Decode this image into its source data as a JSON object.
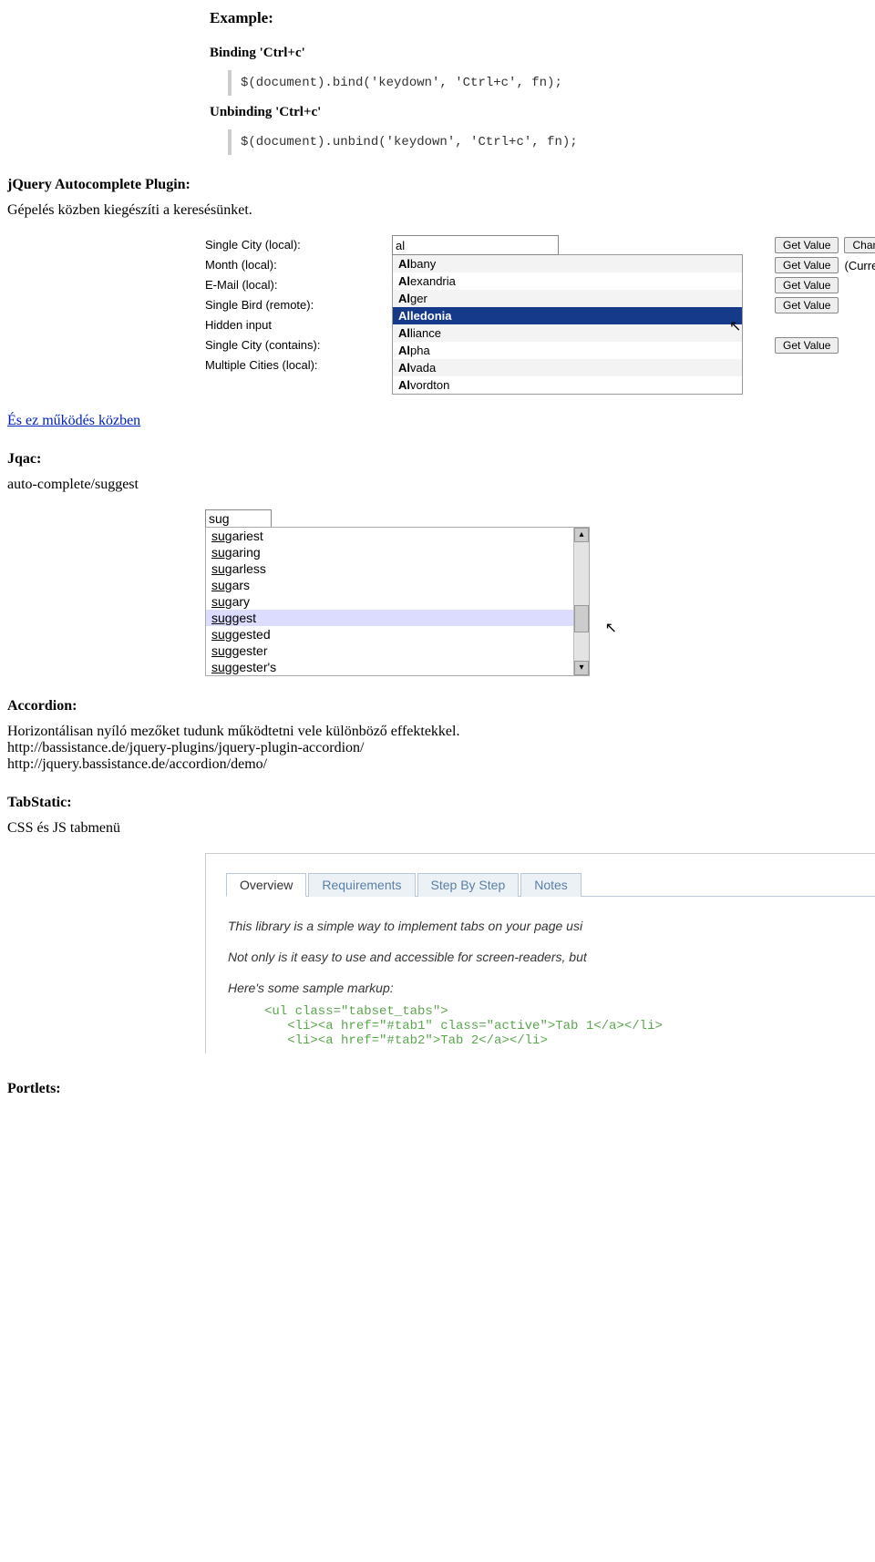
{
  "example": {
    "heading": "Example:",
    "bind_title": "Binding 'Ctrl+c'",
    "bind_code": "$(document).bind('keydown', 'Ctrl+c', fn);",
    "unbind_title": "Unbinding 'Ctrl+c'",
    "unbind_code": "$(document).unbind('keydown', 'Ctrl+c', fn);"
  },
  "autocomplete": {
    "heading": "jQuery Autocomplete Plugin:",
    "desc": "Gépelés közben kiegészíti a keresésünket.",
    "labels": [
      "Single City (local):",
      "Month (local):",
      "E-Mail (local):",
      "Single Bird (remote):",
      "Hidden input",
      "Single City (contains):",
      "Multiple Cities (local):"
    ],
    "input_value": "al",
    "suggestions": [
      "Albany",
      "Alexandria",
      "Alger",
      "Alledonia",
      "Alliance",
      "Alpha",
      "Alvada",
      "Alvordton"
    ],
    "selected_index": 3,
    "btn_get": "Get Value",
    "btn_change": "Change M",
    "text_current": "(Current m",
    "link_text": "És ez működés közben"
  },
  "jqac": {
    "heading": "Jqac:",
    "desc": "auto-complete/suggest",
    "input_value": "sug",
    "suggestions": [
      "sugariest",
      "sugaring",
      "sugarless",
      "sugars",
      "sugary",
      "suggest",
      "suggested",
      "suggester",
      "suggester's"
    ],
    "highlight_index": 5,
    "underline_len": 3
  },
  "accordion": {
    "heading": "Accordion:",
    "desc": "Horizontálisan nyíló mezőket tudunk működtetni vele különböző effektekkel.",
    "url1": "http://bassistance.de/jquery-plugins/jquery-plugin-accordion/",
    "url2": "http://jquery.bassistance.de/accordion/demo/"
  },
  "tabstatic": {
    "heading": "TabStatic:",
    "desc": "CSS és JS tabmenü",
    "tabs": [
      "Overview",
      "Requirements",
      "Step By Step",
      "Notes"
    ],
    "active_tab": 0,
    "body_line1": "This library is a simple way to implement tabs on your page usi",
    "body_line2": "Not only is it easy to use and accessible for screen-readers, but",
    "body_line3": "Here's some sample markup:",
    "sample_code": "<ul class=\"tabset_tabs\">\n   <li><a href=\"#tab1\" class=\"active\">Tab 1</a></li>\n   <li><a href=\"#tab2\">Tab 2</a></li>"
  },
  "portlets": {
    "heading": "Portlets:"
  }
}
